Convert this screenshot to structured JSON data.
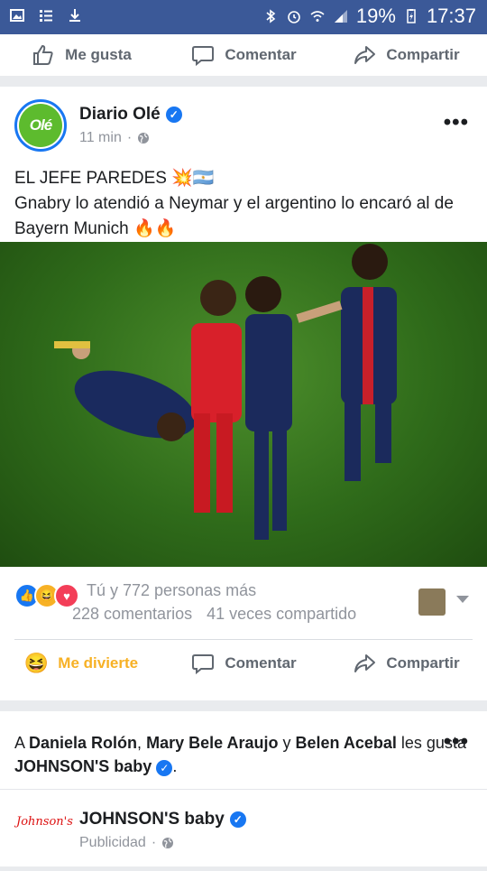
{
  "status_bar": {
    "battery": "19%",
    "time": "17:37"
  },
  "top_actions": {
    "like": "Me gusta",
    "comment": "Comentar",
    "share": "Compartir"
  },
  "post": {
    "page_name": "Diario Olé",
    "avatar_text": "Olé",
    "time": "11 min",
    "text_line1": "EL JEFE PAREDES 💥🇦🇷",
    "text_line2": "Gnabry lo atendió a Neymar y el argentino lo encaró al de Bayern Munich 🔥🔥",
    "reactions_text": "Tú y 772 personas más",
    "comments_count": "228 comentarios",
    "shares_count": "41 veces compartido",
    "actions": {
      "reaction": "Me divierte",
      "comment": "Comentar",
      "share": "Compartir"
    },
    "colors": {
      "blue": "#1877f2",
      "haha_yellow": "#f7b125",
      "green_field": "#3d7f22"
    }
  },
  "social_context": {
    "prefix": "A",
    "names": [
      "Daniela Rolón",
      "Mary Bele Araujo",
      "Belen Acebal"
    ],
    "sep1": ",",
    "sep2": "y",
    "middle": "les gusta",
    "page": "JOHNSON'S baby",
    "end": "."
  },
  "ad": {
    "page_name": "JOHNSON'S baby",
    "meta": "Publicidad",
    "logo_text": "Johnson's"
  }
}
